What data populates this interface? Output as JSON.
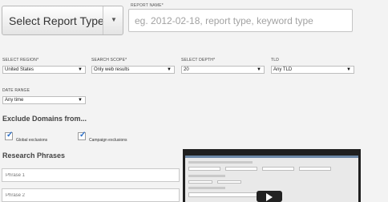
{
  "report_type": {
    "label": "Select Report Type"
  },
  "report_name": {
    "label": "REPORT NAME*",
    "placeholder": "eg. 2012-02-18, report type, keyword type"
  },
  "region": {
    "label": "SELECT REGION*",
    "value": "United States"
  },
  "search_scope": {
    "label": "SEARCH SCOPE*",
    "value": "Only web results"
  },
  "depth": {
    "label": "SELECT DEPTH*",
    "value": "20"
  },
  "tld": {
    "label": "TLD",
    "value": "Any TLD"
  },
  "date_range": {
    "label": "DATE RANGE",
    "value": "Any time"
  },
  "exclude_domains": {
    "title": "Exclude Domains from...",
    "global": {
      "label": "Global exclusions",
      "checked": true
    },
    "campaign": {
      "label": "Campaign exclusions",
      "checked": true
    }
  },
  "research_phrases": {
    "title": "Research Phrases",
    "phrases": [
      {
        "placeholder": "Phrase 1"
      },
      {
        "placeholder": "Phrase 2"
      }
    ]
  },
  "video": {
    "kind": "tutorial-video-thumbnail",
    "icon": "play-icon"
  }
}
